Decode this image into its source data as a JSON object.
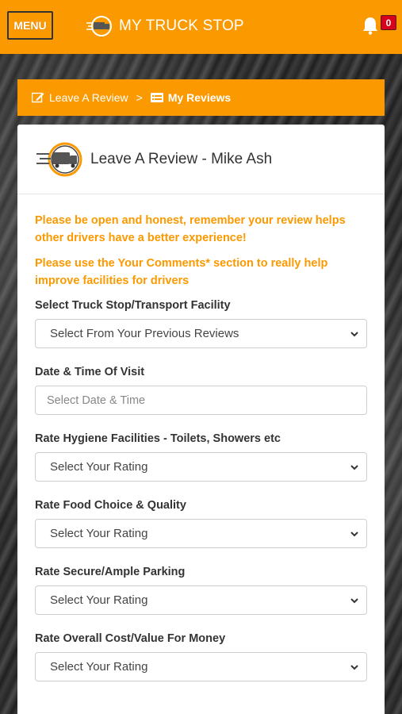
{
  "topbar": {
    "menu_label": "MENU",
    "brand_name": "MY TRUCK STOP",
    "notification_count": "0"
  },
  "breadcrumb": {
    "items": [
      {
        "label": "Leave A Review",
        "icon": "edit-icon"
      },
      {
        "label": "My Reviews",
        "icon": "list-icon"
      }
    ],
    "separator": ">"
  },
  "card": {
    "title": "Leave A Review - Mike Ash",
    "notices": [
      "Please be open and honest, remember your review helps other drivers have a better experience!",
      "Please use the Your Comments* section to really help improve facilities for drivers"
    ],
    "fields": [
      {
        "label": "Select Truck Stop/Transport Facility",
        "type": "select",
        "value": "Select From Your Previous Reviews"
      },
      {
        "label": "Date & Time Of Visit",
        "type": "input",
        "placeholder": "Select Date & Time"
      },
      {
        "label": "Rate Hygiene Facilities - Toilets, Showers etc",
        "type": "select",
        "value": "Select Your Rating"
      },
      {
        "label": "Rate Food Choice & Quality",
        "type": "select",
        "value": "Select Your Rating"
      },
      {
        "label": "Rate Secure/Ample Parking",
        "type": "select",
        "value": "Select Your Rating"
      },
      {
        "label": "Rate Overall Cost/Value For Money",
        "type": "select",
        "value": "Select Your Rating"
      }
    ]
  },
  "colors": {
    "brand_orange": "#fb9900",
    "badge_red": "#d9001b",
    "text_dark": "#333333"
  }
}
